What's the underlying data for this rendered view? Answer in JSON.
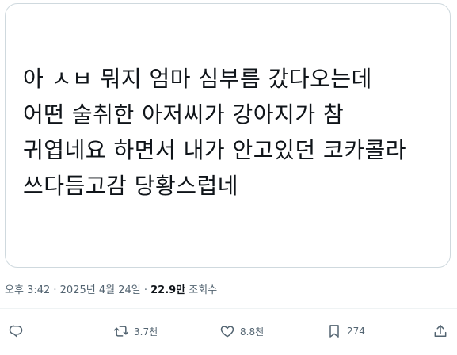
{
  "tweet": {
    "text_lines": [
      "아 ㅅㅂ 뭐지 엄마 심부름 갔다오는데",
      "어떤 술취한 아저씨가 강아지가 참",
      "귀엽네요 하면서 내가 안고있던 코카콜라",
      "쓰다듬고감 당황스럽네"
    ]
  },
  "meta": {
    "time": "오후 3:42",
    "separator": " · ",
    "date": "2025년 4월 24일",
    "views_count": "22.9만",
    "views_label": "조회수"
  },
  "actions": {
    "reply": {
      "icon": "reply-icon",
      "count": ""
    },
    "retweet": {
      "icon": "retweet-icon",
      "count": "3.7천"
    },
    "like": {
      "icon": "heart-icon",
      "count": "8.8천"
    },
    "bookmark": {
      "icon": "bookmark-icon",
      "count": "274"
    },
    "share": {
      "icon": "share-icon",
      "count": ""
    }
  },
  "colors": {
    "text": "#0f1419",
    "secondary": "#536471",
    "border": "#cfd9de"
  }
}
